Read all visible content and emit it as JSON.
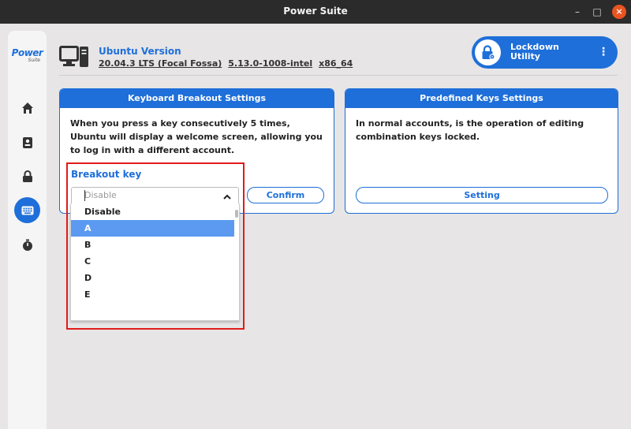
{
  "window": {
    "title": "Power Suite",
    "min": "–",
    "max": "□",
    "close": "×"
  },
  "logo": {
    "big": "Power",
    "small": "Suite"
  },
  "sidebar": {
    "items": [
      "home-icon",
      "id-card-icon",
      "lock-icon",
      "keyboard-icon",
      "timer-icon"
    ],
    "active_index": 3
  },
  "header": {
    "version_title": "Ubuntu Version",
    "version_name": "20.04.3 LTS (Focal Fossa)",
    "kernel": "5.13.0-1008-intel",
    "arch": "x86_64"
  },
  "lockdown": {
    "line1": "Lockdown",
    "line2": "Utility",
    "menu": "⋮"
  },
  "keyboard_card": {
    "title": "Keyboard Breakout Settings",
    "description": "When you press a key consecutively 5 times, Ubuntu will display a welcome screen, allowing you to log in with a different account.",
    "breakout_label": "Breakout key",
    "combo_value": "Disable",
    "confirm_label": "Confirm",
    "options": [
      "Disable",
      "A",
      "B",
      "C",
      "D",
      "E"
    ],
    "selected_option": "A"
  },
  "predefined_card": {
    "title": "Predefined Keys Settings",
    "description": "In normal accounts, is the operation of editing combination keys locked.",
    "setting_label": "Setting"
  },
  "colors": {
    "accent": "#1e6fd9",
    "selected": "#5b9af0",
    "highlight": "#e01b1b",
    "close": "#e95420"
  }
}
